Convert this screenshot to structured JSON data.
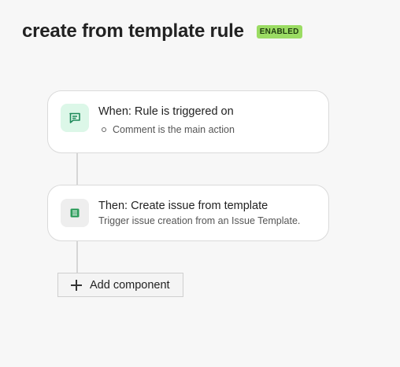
{
  "header": {
    "title": "create from template rule",
    "status_badge": "ENABLED"
  },
  "flow": {
    "trigger": {
      "heading": "When: Rule is triggered on",
      "detail": "Comment is the main action",
      "icon": "comment-icon"
    },
    "action": {
      "heading": "Then: Create issue from template",
      "detail": "Trigger issue creation from an Issue Template.",
      "icon": "template-list-icon"
    },
    "add_component_label": "Add component"
  },
  "colors": {
    "badge_bg": "#9bdc63",
    "trigger_icon_bg": "#dcf7e8",
    "trigger_icon_fg": "#1f8a5b",
    "action_icon_fg": "#2e9d5c"
  }
}
